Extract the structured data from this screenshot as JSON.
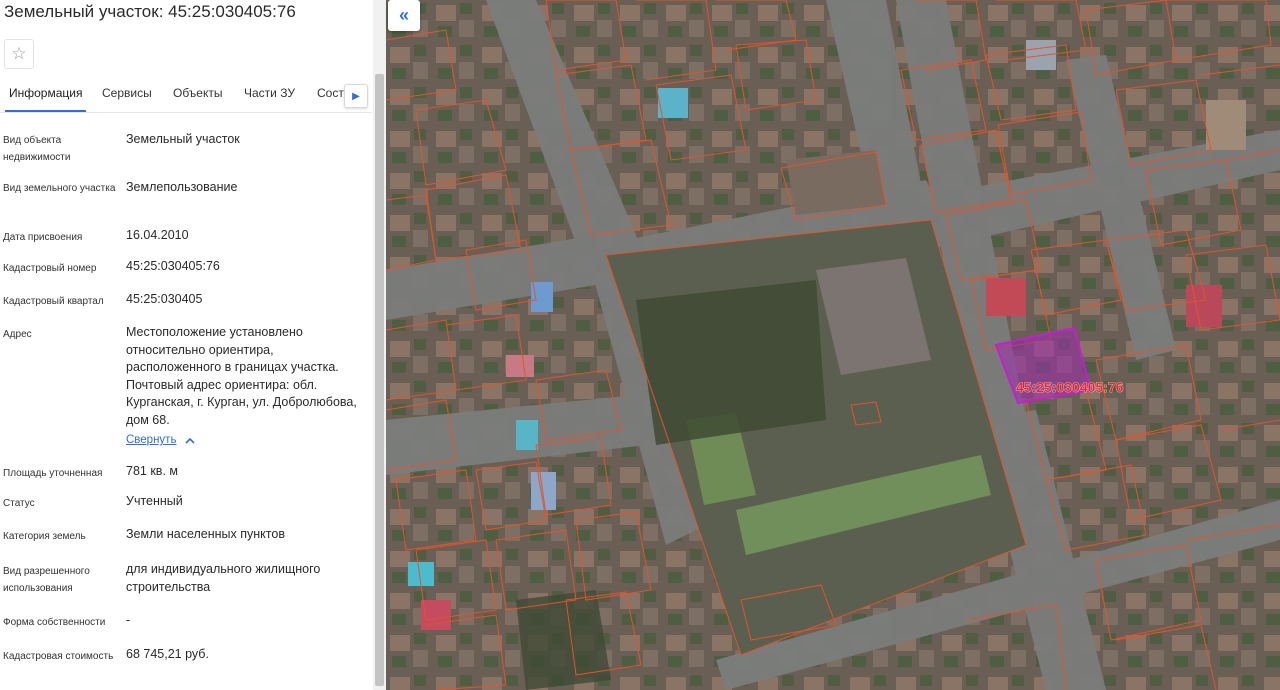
{
  "panel": {
    "title": "Земельный участок: 45:25:030405:76",
    "fav_icon": "star-icon",
    "tabs": [
      {
        "label": "Информация",
        "active": true
      },
      {
        "label": "Сервисы",
        "active": false
      },
      {
        "label": "Объекты",
        "active": false
      },
      {
        "label": "Части ЗУ",
        "active": false
      },
      {
        "label": "Состав",
        "active": false
      }
    ],
    "rows": [
      {
        "label": "Вид объекта недвижимости",
        "value": "Земельный участок"
      },
      {
        "label": "Вид земельного участка",
        "value": "Землепользование"
      },
      {
        "label": "Дата присвоения",
        "value": "16.04.2010"
      },
      {
        "label": "Кадастровый номер",
        "value": "45:25:030405:76"
      },
      {
        "label": "Кадастровый квартал",
        "value": "45:25:030405"
      },
      {
        "label": "Адрес",
        "value": "Местоположение установлено относительно ориентира, расположенного в границах участка. Почтовый адрес ориентира: обл. Курганская, г. Курган, ул. Добролюбова, дом 68."
      },
      {
        "label": "Площадь уточненная",
        "value": "781 кв. м"
      },
      {
        "label": "Статус",
        "value": "Учтенный"
      },
      {
        "label": "Категория земель",
        "value": "Земли населенных пунктов"
      },
      {
        "label": "Вид разрешенного использования",
        "value": "для индивидуального жилищного строительства"
      },
      {
        "label": "Форма собственности",
        "value": "-"
      },
      {
        "label": "Кадастровая стоимость",
        "value": "68 745,21 руб."
      }
    ],
    "collapse_label": "Свернуть"
  },
  "map": {
    "parcel_label": "45:25:030405:76",
    "parcel_color": "#c21fd1",
    "boundary_color": "#e0552b",
    "collapse_icon": "double-chevron-left-icon"
  }
}
